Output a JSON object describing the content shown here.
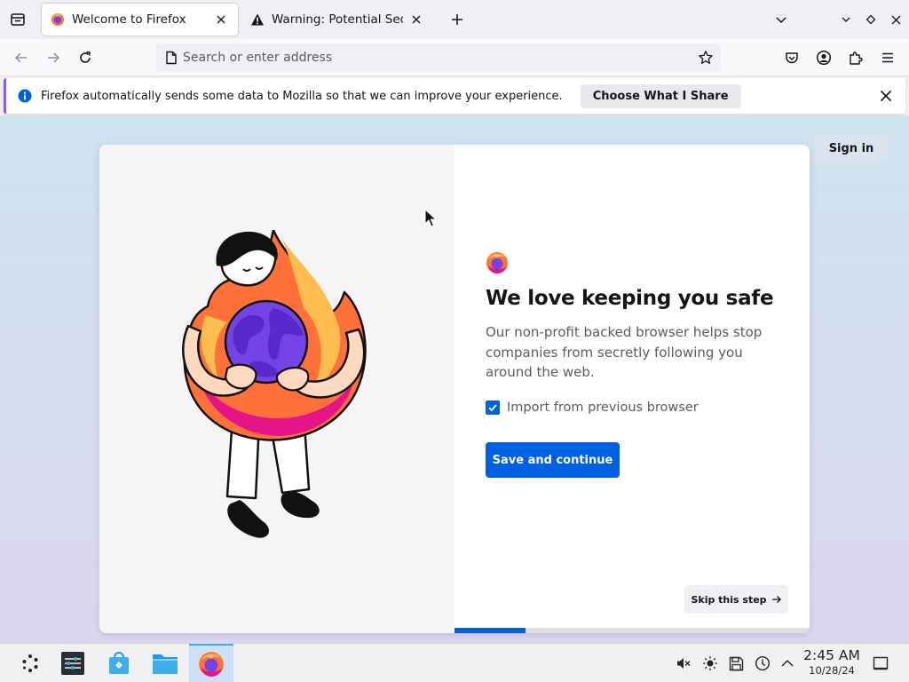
{
  "browser": {
    "tabs": [
      {
        "title": "Welcome to Firefox",
        "favicon": "firefox-icon",
        "active": true
      },
      {
        "title": "Warning: Potential Security Risk Ahead",
        "favicon": "warning-icon",
        "active": false
      }
    ],
    "address_bar": {
      "placeholder": "Search or enter address",
      "value": ""
    },
    "icons": {
      "tab_overview": "tab-overview-icon",
      "new_tab": "plus-icon",
      "list_tabs": "chevron-down-icon",
      "back": "back-arrow-icon",
      "forward": "forward-arrow-icon",
      "reload": "reload-icon",
      "bookmark": "star-icon",
      "pocket": "pocket-icon",
      "account": "account-icon",
      "extensions": "puzzle-icon",
      "menu": "hamburger-menu-icon"
    }
  },
  "notification": {
    "message": "Firefox automatically sends some data to Mozilla so that we can improve your experience.",
    "button_label": "Choose What I Share",
    "accent": "#9059ff"
  },
  "page": {
    "sign_in_label": "Sign in",
    "headline": "We love keeping you safe",
    "subtext": "Our non-profit backed browser helps stop companies from secretly following you around the web.",
    "import_label": "Import from previous browser",
    "import_checked": true,
    "primary_button": "Save and continue",
    "skip_button": "Skip this step",
    "progress_fraction": 0.2,
    "accent_color": "#0061e0"
  },
  "taskbar": {
    "apps": [
      "app-launcher-icon",
      "system-settings-icon",
      "discover-store-icon",
      "file-manager-icon",
      "firefox-icon"
    ],
    "tray": [
      "speaker-muted-icon",
      "brightness-icon",
      "save-icon",
      "updates-icon",
      "chevron-up-icon",
      "show-desktop-icon"
    ],
    "time": "2:45 AM",
    "date": "10/28/24"
  }
}
